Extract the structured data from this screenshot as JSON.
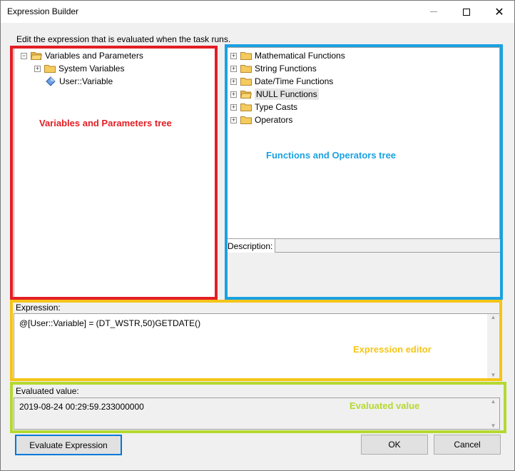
{
  "window": {
    "title": "Expression Builder",
    "instruction": "Edit the expression that is evaluated when the task runs."
  },
  "variables_tree": {
    "root_label": "Variables and Parameters",
    "children": [
      {
        "label": "System Variables",
        "icon": "folder-icon",
        "expandable": true
      },
      {
        "label": "User::Variable",
        "icon": "variable-icon",
        "expandable": false
      }
    ]
  },
  "functions_tree": {
    "items": [
      "Mathematical Functions",
      "String Functions",
      "Date/Time Functions",
      "NULL Functions",
      "Type Casts",
      "Operators"
    ]
  },
  "description": {
    "label": "Description:"
  },
  "expression": {
    "label": "Expression:",
    "value": "@[User::Variable] = (DT_WSTR,50)GETDATE()"
  },
  "evaluated": {
    "label": "Evaluated value:",
    "value": "2019-08-24 00:29:59.233000000"
  },
  "buttons": {
    "evaluate": "Evaluate Expression",
    "ok": "OK",
    "cancel": "Cancel"
  },
  "annotations": {
    "variables_tree": "Variables and Parameters tree",
    "functions_tree": "Functions and Operators tree",
    "expression_editor": "Expression editor",
    "evaluated_value": "Evaluated value"
  },
  "colors": {
    "red": "#e31e24",
    "blue": "#1ba1e2",
    "yellow": "#f5c518",
    "green": "#b5d931",
    "dialog_bg": "#f0f0f0"
  }
}
